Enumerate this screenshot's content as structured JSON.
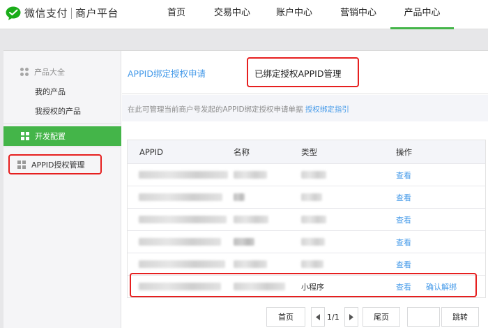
{
  "brand": {
    "name": "微信支付",
    "subtitle": "商户平台",
    "logo_icon": "wechat-pay-logo-icon",
    "accent": "#44b549"
  },
  "nav": {
    "items": [
      {
        "label": "首页"
      },
      {
        "label": "交易中心"
      },
      {
        "label": "账户中心"
      },
      {
        "label": "营销中心"
      },
      {
        "label": "产品中心",
        "active": true
      }
    ]
  },
  "sidebar": {
    "group_title": "产品大全",
    "links": [
      "我的产品",
      "我授权的产品"
    ],
    "active_section": "开发配置",
    "item": "APPID授权管理"
  },
  "tabs": {
    "apply": "APPID绑定授权申请",
    "bound": "已绑定授权APPID管理"
  },
  "info": {
    "text": "在此可管理当前商户号发起的APPID绑定授权申请单据",
    "link": "授权绑定指引"
  },
  "table": {
    "headers": [
      "APPID",
      "名称",
      "类型",
      "操作"
    ],
    "rows": [
      {
        "type": "",
        "action": "查看"
      },
      {
        "type": "",
        "action": "查看"
      },
      {
        "type": "",
        "action": "查看"
      },
      {
        "type": "",
        "action": "查看"
      },
      {
        "type": "",
        "action": "查看"
      },
      {
        "type": "小程序",
        "action": "查看",
        "extra_action": "确认解绑"
      }
    ]
  },
  "pagination": {
    "first": "首页",
    "page": "1/1",
    "last": "尾页",
    "jump": "跳转",
    "jump_value": ""
  },
  "highlight_color": "#e61f1f"
}
